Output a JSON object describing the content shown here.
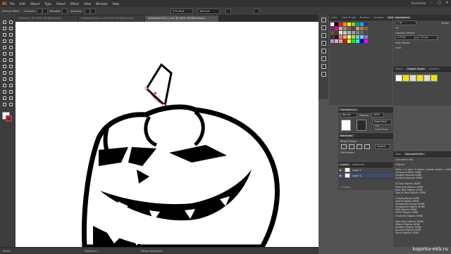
{
  "app": {
    "logo": "Ai"
  },
  "menu": [
    "File",
    "Edit",
    "Object",
    "Type",
    "Select",
    "Effect",
    "View",
    "Window",
    "Help"
  ],
  "workspace": "Essentials",
  "window_controls": [
    "–",
    "□",
    "×"
  ],
  "control_bar": {
    "selection_label": "Anchor Point",
    "convert_label": "Convert:",
    "handles_label": "Handles:",
    "anchors_label": "Anchors:",
    "x_value": "575.26 pt",
    "y_value": "340.6 pt"
  },
  "tabs": [
    {
      "label": "Untitled-1 @ 100% (RGB/Preview)",
      "active": false
    },
    {
      "label": "halloween2011.ai @ 100% (RGB/Preview)",
      "active": false
    },
    {
      "label": "halloween2012_2.ai* @ 400% (RGB/Preview)",
      "active": true
    }
  ],
  "status": {
    "zoom": "400%",
    "artboard": "Artboard 1",
    "tool": "Direct Selection"
  },
  "swatches_panel": {
    "tabs": [
      "Color",
      "Color Guide",
      "Brushes",
      "Symbols",
      "Swatches"
    ],
    "active": "Swatches"
  },
  "appearance_panel": {
    "title": "Appearance",
    "stroke_weight": "1 pt",
    "options": [
      "Stroke",
      "Fill",
      "Opacity: Default"
    ],
    "dims": {
      "w": "3.75 pt",
      "h": "2.51 pt"
    },
    "align_label": "Align Stroke",
    "corner_label": "Limit"
  },
  "graphic_styles_panel": {
    "tabs": [
      "Stroke",
      "Graphic Styles",
      "Gradient",
      "Transparency"
    ],
    "active": "Graphic Styles"
  },
  "transparency_panel": {
    "title": "Transparency",
    "mode": "Normal",
    "opacity_label": "Opacity:",
    "opacity": "100%",
    "make_mask": "Make Mask",
    "clip": "Clip",
    "invert": "Invert Mask"
  },
  "pathfinder_panel": {
    "title": "Pathfinder",
    "shape_modes": "Shape Modes:",
    "pathfinders": "Pathfinders:",
    "expand": "Expand"
  },
  "layers_panel": {
    "tabs": [
      "Layers",
      "Artboards"
    ],
    "rows": [
      {
        "name": "Layer 2",
        "selected": false
      },
      {
        "name": "Layer 1",
        "selected": true
      }
    ],
    "footer": "2 Layers"
  },
  "info_panel": {
    "tabs": [
      "Align",
      "Document Info"
    ],
    "title": "Document Info",
    "header": "Objects:",
    "lines": [
      "Paths: 1 (1 open, 0 closed, 3 points, length = 106.88 pt)",
      "Compound Paths: NONE",
      "Gradient Meshes: NONE",
      "Symbol Instances: NONE",
      "",
      "All Type Objects: NONE",
      "Point Type Objects: NONE",
      "Area Type Objects: NONE",
      "Type on Path Objects: NONE",
      "",
      "Clipping Masks: NONE",
      "Opacity Masks: NONE",
      "Transparent Groups: NONE",
      "Transparent Objects: NONE",
      "RGB Objects: NONE",
      "CMYK Objects: NONE",
      "Grayscale Objects: NONE",
      "",
      "Spot Color Objects: NONE",
      "Pattern Objects: NONE",
      "Gradient Objects: NONE",
      "Brushed Objects: NONE",
      "Styled Objects: NONE"
    ]
  },
  "watermark": "kopirka-ekb.ru",
  "colors": {
    "accent": "#f07d1d",
    "ui_dark": "#323232",
    "ui_mid": "#535353",
    "canvas": "#ffffff",
    "selection": "#e0245e"
  }
}
